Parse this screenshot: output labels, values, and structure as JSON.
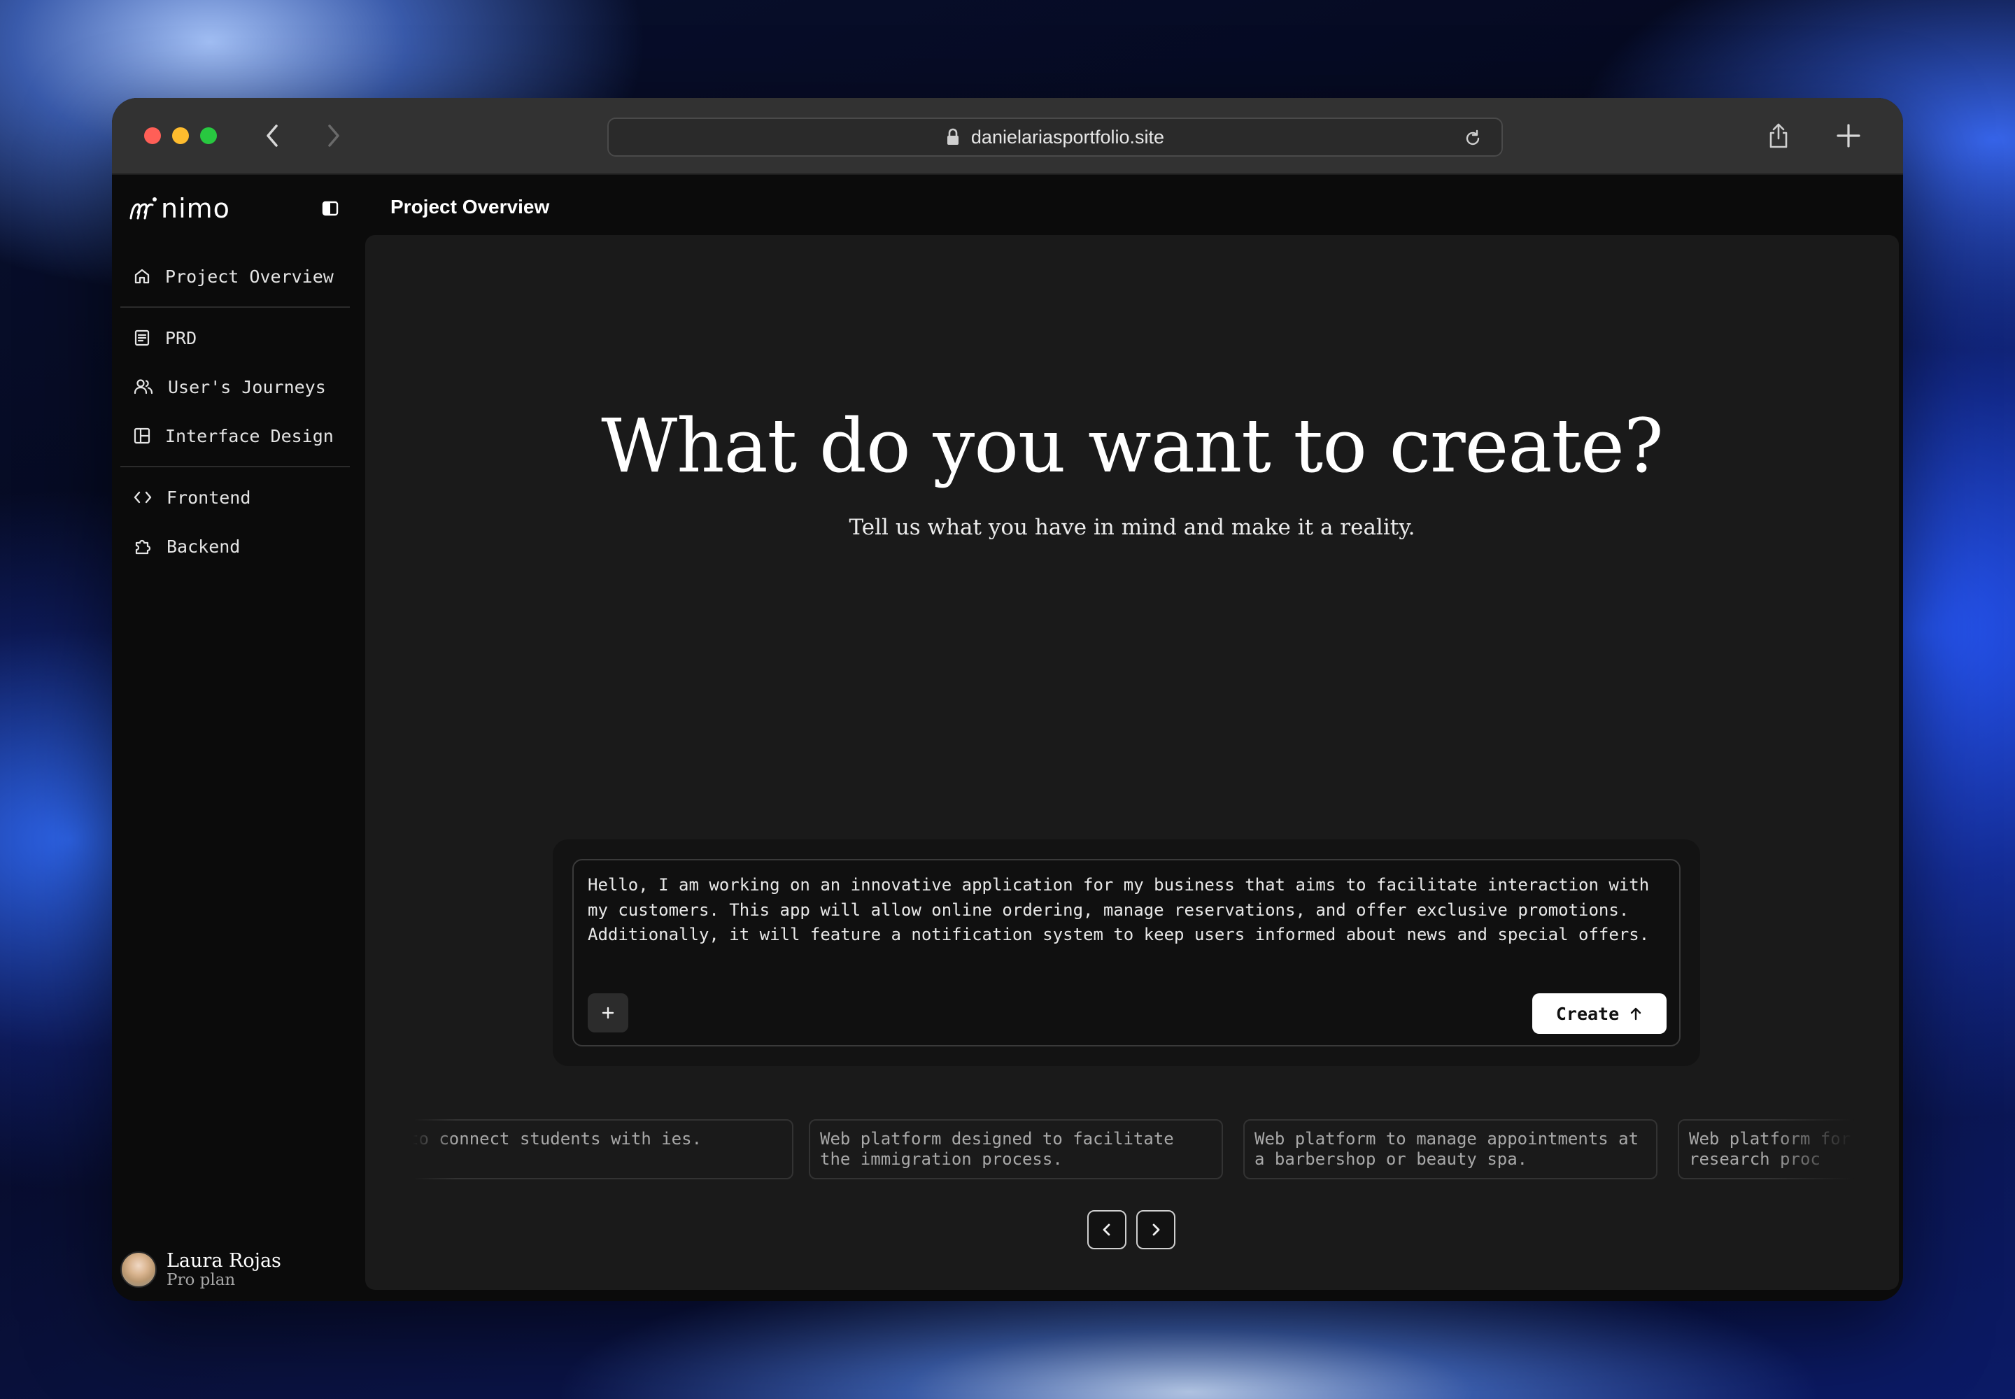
{
  "browser": {
    "url": "danielariasportfolio.site"
  },
  "sidebar": {
    "logo_text": "nimo",
    "items": [
      {
        "label": "Project Overview",
        "icon": "home-icon"
      },
      {
        "label": "PRD",
        "icon": "document-icon"
      },
      {
        "label": "User's Journeys",
        "icon": "users-icon"
      },
      {
        "label": "Interface Design",
        "icon": "layout-icon"
      },
      {
        "label": "Frontend",
        "icon": "code-icon"
      },
      {
        "label": "Backend",
        "icon": "puzzle-icon"
      }
    ],
    "user": {
      "name": "Laura Rojas",
      "plan": "Pro plan"
    }
  },
  "header": {
    "title": "Project Overview"
  },
  "main": {
    "hero_title": "What do you want to create?",
    "hero_subtitle": "Tell us what you have in mind and make it a reality.",
    "prompt": {
      "value": "Hello, I am working on an innovative application for my business that aims to facilitate interaction with my customers. This app will allow online ordering, manage reservations, and offer exclusive promotions. Additionally, it will feature a notification system to keep users informed about news and special offers.",
      "attach_label": "+",
      "create_label": "Create"
    },
    "suggestions": [
      "to connect students with ies.",
      "Web platform designed to facilitate the immigration process.",
      "Web platform to manage appointments at a barbershop or beauty spa.",
      "Web platform for conduc marketing research proc"
    ]
  },
  "colors": {
    "window_bg": "#0b0b0b",
    "panel_bg": "#1a1a1a",
    "chrome_bg": "#323232",
    "accent_button": "#ffffff"
  }
}
